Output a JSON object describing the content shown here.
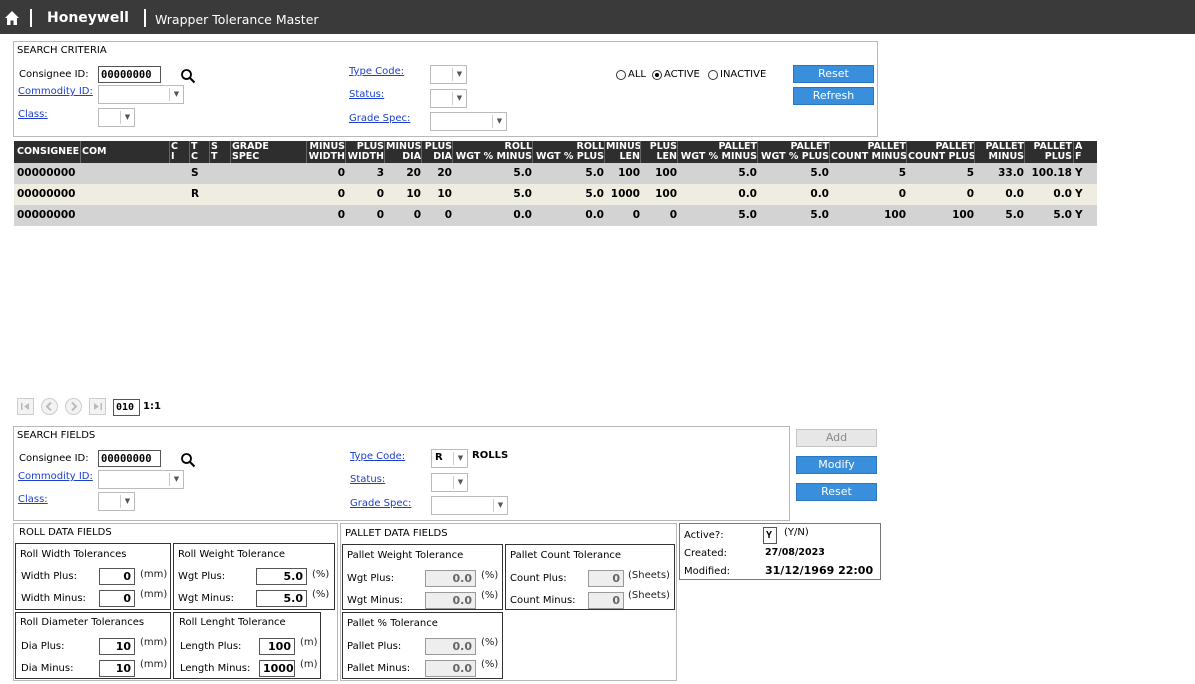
{
  "header": {
    "brand": "Honeywell",
    "title": "Wrapper Tolerance Master"
  },
  "search_criteria": {
    "title": "SEARCH CRITERIA",
    "consignee_label": "Consignee ID:",
    "consignee_value": "00000000",
    "commodity_label": "Commodity ID:",
    "class_label": "Class:",
    "type_code_label": "Type Code:",
    "status_label": "Status:",
    "grade_spec_label": "Grade Spec:",
    "radio_all": "ALL",
    "radio_active": "ACTIVE",
    "radio_inactive": "INACTIVE",
    "selected_radio": "ACTIVE",
    "reset_label": "Reset",
    "refresh_label": "Refresh"
  },
  "grid": {
    "columns": [
      {
        "h1": "CONSIGNEE",
        "h2": ""
      },
      {
        "h1": "COM",
        "h2": ""
      },
      {
        "h1": "C",
        "h2": "I"
      },
      {
        "h1": "T",
        "h2": "C"
      },
      {
        "h1": "S",
        "h2": "T"
      },
      {
        "h1": "GRADE",
        "h2": "SPEC"
      },
      {
        "h1": "MINUS",
        "h2": "WIDTH"
      },
      {
        "h1": "PLUS",
        "h2": "WIDTH"
      },
      {
        "h1": "MINUS",
        "h2": "DIA"
      },
      {
        "h1": "PLUS",
        "h2": "DIA"
      },
      {
        "h1": "ROLL",
        "h2": "WGT % MINUS"
      },
      {
        "h1": "ROLL",
        "h2": "WGT % PLUS"
      },
      {
        "h1": "MINUS",
        "h2": "LEN"
      },
      {
        "h1": "PLUS",
        "h2": "LEN"
      },
      {
        "h1": "PALLET",
        "h2": "WGT % MINUS"
      },
      {
        "h1": "PALLET",
        "h2": "WGT % PLUS"
      },
      {
        "h1": "PALLET",
        "h2": "COUNT MINUS"
      },
      {
        "h1": "PALLET",
        "h2": "COUNT PLUS"
      },
      {
        "h1": "PALLET",
        "h2": "MINUS"
      },
      {
        "h1": "PALLET",
        "h2": "PLUS"
      },
      {
        "h1": "A",
        "h2": "F"
      }
    ],
    "rows": [
      {
        "consignee": "00000000",
        "tc": "S",
        "minus_width": "0",
        "plus_width": "3",
        "minus_dia": "20",
        "plus_dia": "20",
        "roll_wgt_minus": "5.0",
        "roll_wgt_plus": "5.0",
        "minus_len": "100",
        "plus_len": "100",
        "pallet_wgt_minus": "5.0",
        "pallet_wgt_plus": "5.0",
        "pallet_count_minus": "5",
        "pallet_count_plus": "5",
        "pallet_minus": "33.0",
        "pallet_plus": "100.18",
        "af": "Y"
      },
      {
        "consignee": "00000000",
        "tc": "R",
        "minus_width": "0",
        "plus_width": "0",
        "minus_dia": "10",
        "plus_dia": "10",
        "roll_wgt_minus": "5.0",
        "roll_wgt_plus": "5.0",
        "minus_len": "1000",
        "plus_len": "100",
        "pallet_wgt_minus": "0.0",
        "pallet_wgt_plus": "0.0",
        "pallet_count_minus": "0",
        "pallet_count_plus": "0",
        "pallet_minus": "0.0",
        "pallet_plus": "0.0",
        "af": "Y"
      },
      {
        "consignee": "00000000",
        "tc": "",
        "minus_width": "0",
        "plus_width": "0",
        "minus_dia": "0",
        "plus_dia": "0",
        "roll_wgt_minus": "0.0",
        "roll_wgt_plus": "0.0",
        "minus_len": "0",
        "plus_len": "0",
        "pallet_wgt_minus": "5.0",
        "pallet_wgt_plus": "5.0",
        "pallet_count_minus": "100",
        "pallet_count_plus": "100",
        "pallet_minus": "5.0",
        "pallet_plus": "5.0",
        "af": "Y"
      }
    ]
  },
  "pagination": {
    "page_size": "010",
    "page_info": "1:1"
  },
  "search_fields": {
    "title": "SEARCH FIELDS",
    "consignee_label": "Consignee ID:",
    "consignee_value": "00000000",
    "commodity_label": "Commodity ID:",
    "class_label": "Class:",
    "type_code_label": "Type Code:",
    "type_code_value": "R",
    "type_code_desc": "ROLLS",
    "status_label": "Status:",
    "grade_spec_label": "Grade Spec:",
    "add_label": "Add",
    "modify_label": "Modify",
    "reset_label": "Reset"
  },
  "roll_data": {
    "title": "ROLL DATA FIELDS",
    "width": {
      "title": "Roll Width Tolerances",
      "plus_label": "Width Plus:",
      "plus_value": "0",
      "minus_label": "Width Minus:",
      "minus_value": "0",
      "unit": "(mm)"
    },
    "weight": {
      "title": "Roll Weight Tolerance",
      "plus_label": "Wgt Plus:",
      "plus_value": "5.0",
      "minus_label": "Wgt Minus:",
      "minus_value": "5.0",
      "unit": "(%)"
    },
    "diameter": {
      "title": "Roll Diameter Tolerances",
      "plus_label": "Dia Plus:",
      "plus_value": "10",
      "minus_label": "Dia Minus:",
      "minus_value": "10",
      "unit": "(mm)"
    },
    "length": {
      "title": "Roll Lenght Tolerance",
      "plus_label": "Length Plus:",
      "plus_value": "100",
      "minus_label": "Length Minus:",
      "minus_value": "1000",
      "unit": "(m)"
    }
  },
  "pallet_data": {
    "title": "PALLET DATA FIELDS",
    "weight": {
      "title": "Pallet Weight Tolerance",
      "plus_label": "Wgt Plus:",
      "plus_value": "0.0",
      "minus_label": "Wgt Minus:",
      "minus_value": "0.0",
      "unit": "(%)"
    },
    "count": {
      "title": "Pallet Count Tolerance",
      "plus_label": "Count Plus:",
      "plus_value": "0",
      "minus_label": "Count Minus:",
      "minus_value": "0",
      "unit": "(Sheets)"
    },
    "percent": {
      "title": "Pallet % Tolerance",
      "plus_label": "Pallet Plus:",
      "plus_value": "0.0",
      "minus_label": "Pallet Minus:",
      "minus_value": "0.0",
      "unit": "(%)"
    }
  },
  "record_info": {
    "active_label": "Active?:",
    "active_value": "Y",
    "active_hint": "(Y/N)",
    "created_label": "Created:",
    "created_value": "27/08/2023",
    "modified_label": "Modified:",
    "modified_value": "31/12/1969 22:00"
  },
  "colors": {
    "header_bg": "#3a3a3a",
    "button_blue": "#3a8fdc",
    "row_alt_gray": "#d3d3d3",
    "row_alt_beige": "#efece2",
    "link_blue": "#1c3fd0"
  }
}
